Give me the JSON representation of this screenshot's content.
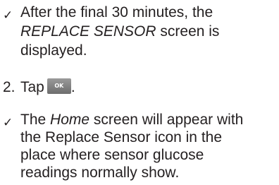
{
  "item1": {
    "mark": "✓",
    "line1": "After the final 30 minutes, the",
    "line2_em": "REPLACE SENSOR",
    "line2_rest": " screen is",
    "line3": "displayed."
  },
  "step2": {
    "number": "2.",
    "text": "Tap",
    "button_label": "OK",
    "suffix": "."
  },
  "item3": {
    "mark": "✓",
    "line1_pre": "The ",
    "line1_em": "Home",
    "line1_post": " screen will appear with",
    "line2": "the Replace Sensor icon in the",
    "line3": "place where sensor glucose",
    "line4": "readings normally show."
  }
}
